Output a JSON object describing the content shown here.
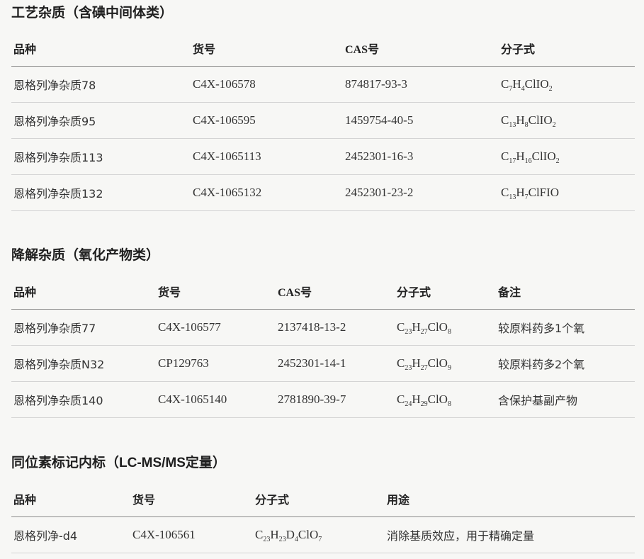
{
  "sections": [
    {
      "title": "工艺杂质（含碘中间体类）",
      "headers": [
        "品种",
        "货号",
        "CAS号",
        "分子式"
      ],
      "rows": [
        [
          "恩格列净杂质78",
          "C4X-106578",
          "874817-93-3",
          "C7H4ClIO2"
        ],
        [
          "恩格列净杂质95",
          "C4X-106595",
          "1459754-40-5",
          "C13H8ClIO2"
        ],
        [
          "恩格列净杂质113",
          "C4X-1065113",
          "2452301-16-3",
          "C17H16ClIO2"
        ],
        [
          "恩格列净杂质132",
          "C4X-1065132",
          "2452301-23-2",
          "C13H7ClFIO"
        ]
      ]
    },
    {
      "title": "降解杂质（氧化产物类）",
      "headers": [
        "品种",
        "货号",
        "CAS号",
        "分子式",
        "备注"
      ],
      "rows": [
        [
          "恩格列净杂质77",
          "C4X-106577",
          "2137418-13-2",
          "C23H27ClO8",
          "较原料药多1个氧"
        ],
        [
          "恩格列净杂质N32",
          "CP129763",
          "2452301-14-1",
          "C23H27ClO9",
          "较原料药多2个氧"
        ],
        [
          "恩格列净杂质140",
          "C4X-1065140",
          "2781890-39-7",
          "C24H29ClO8",
          "含保护基副产物"
        ]
      ]
    },
    {
      "title": "同位素标记内标（LC-MS/MS定量）",
      "headers": [
        "品种",
        "货号",
        "分子式",
        "用途"
      ],
      "rows": [
        [
          "恩格列净-d4",
          "C4X-106561",
          "C23H23D4ClO7",
          "消除基质效应，用于精确定量"
        ]
      ]
    }
  ]
}
